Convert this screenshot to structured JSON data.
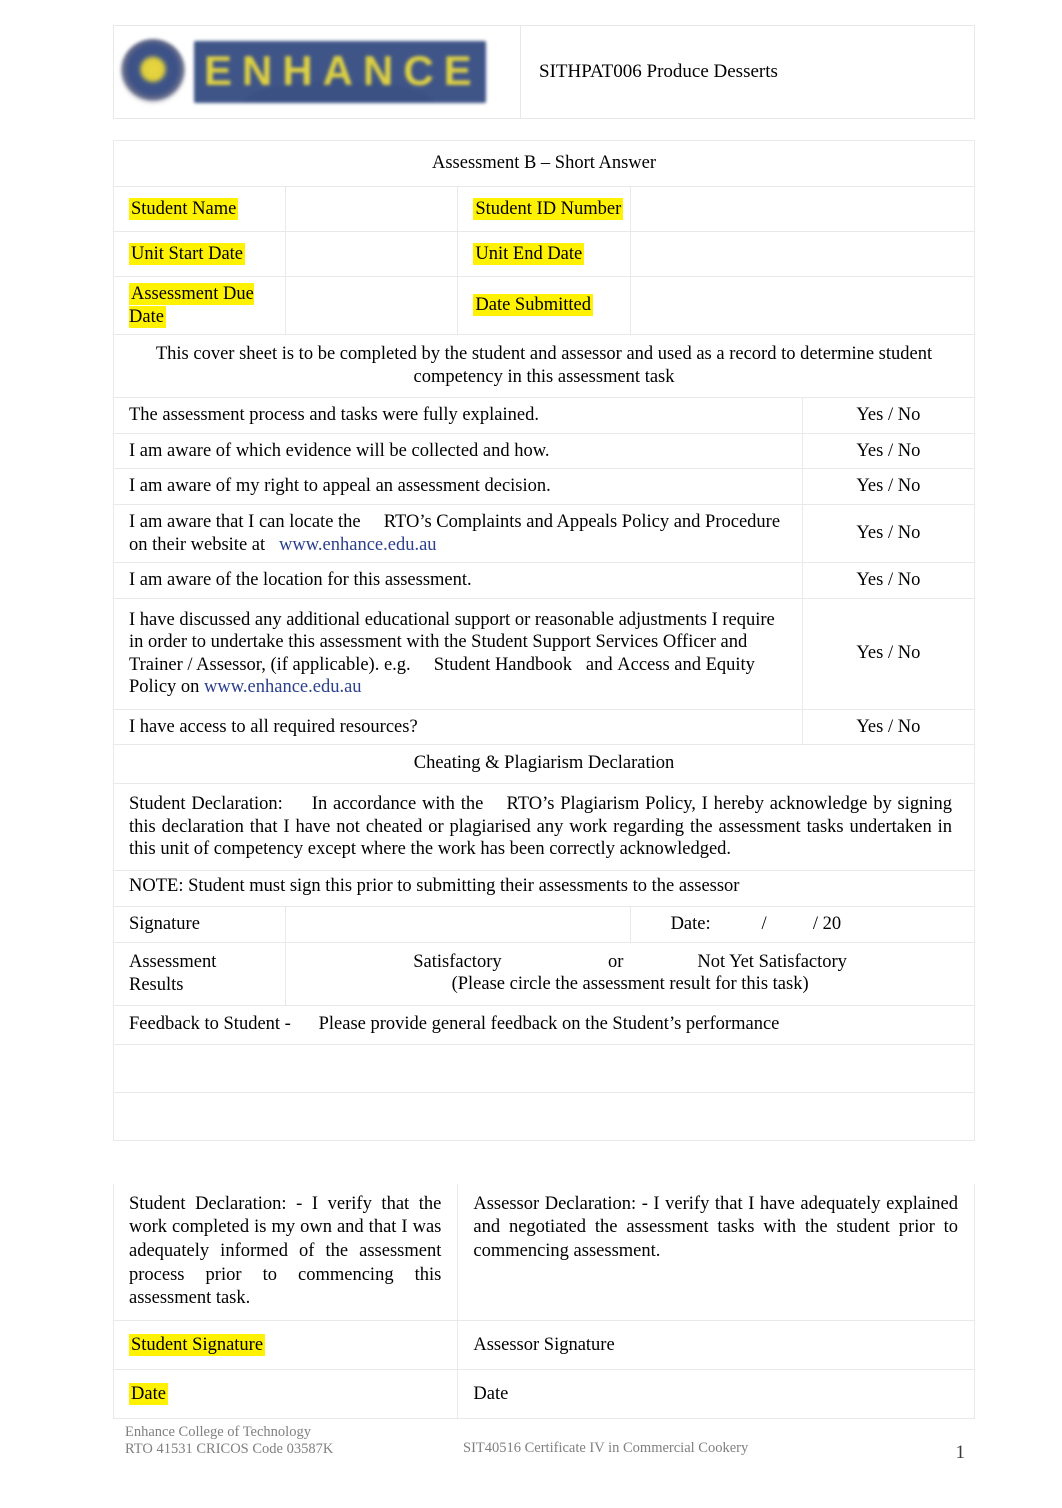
{
  "document": {
    "unit_title": "SITHPAT006 Produce Desserts",
    "assessment_title": "Assessment B – Short Answer",
    "logo_wordmark": "ENHANCE",
    "logo_colors": {
      "band": "#3f5588",
      "letters": "#ddd043",
      "emblem_center": "#e8d641"
    },
    "highlight_color": "#fff200",
    "link_color": "#2b3f8c"
  },
  "student_info": {
    "rows": [
      {
        "left_label": "Student Name",
        "left_value": "",
        "right_label": "Student ID Number",
        "right_value": ""
      },
      {
        "left_label": "Unit Start Date",
        "left_value": "",
        "right_label": "Unit End Date",
        "right_value": ""
      },
      {
        "left_label": "Assessment Due Date",
        "left_value": "",
        "right_label": "Date Submitted",
        "right_value": ""
      }
    ]
  },
  "cover_sheet_note": "This cover sheet is to be completed by the student and assessor and used as a record to determine student competency in this assessment task",
  "checklist": {
    "answer_option": "Yes / No",
    "items": [
      {
        "text": "The assessment process and tasks were fully explained."
      },
      {
        "text": "I am aware of which evidence will be collected and how."
      },
      {
        "text": "I am aware of my right to appeal an assessment decision."
      },
      {
        "text_part1": "I am aware that I can locate the ",
        "text_part2": "RTO",
        "text_part3": "’s Complaints and Appeals Policy and Procedure on their website at ",
        "link": "www.enhance.edu.au"
      },
      {
        "text": "I am aware of the location for this assessment."
      },
      {
        "text_part1": "I have discussed any additional educational support or reasonable adjustments I require in order to undertake this assessment with the Student Support Services Officer and Trainer / Assessor, (if applicable). e.g.",
        "text_part2": "Student Handbook",
        "text_part3": "and",
        "text_part4": "Access and Equity Policy",
        "text_part5": "on",
        "link": "www.enhance.edu.au"
      },
      {
        "text": "I have access to all required resources?"
      }
    ]
  },
  "plagiarism": {
    "heading": "Cheating & Plagiarism Declaration",
    "declaration_part1": "Student Declaration:",
    "declaration_part2": "In accordance with the",
    "declaration_part3": "RTO",
    "declaration_part4": "’s Plagiarism Policy, I hereby acknowledge by signing this declaration that I have not cheated or plagiarised any work regarding the assessment tasks undertaken in this unit of competency except where the work has been correctly acknowledged.",
    "note": "NOTE: Student must sign this prior to submitting their assessments to the assessor"
  },
  "signature_block": {
    "signature_label": "Signature",
    "date_label": "Date:",
    "date_pattern": "/          / 20"
  },
  "assessment_results": {
    "label_line1": "Assessment",
    "label_line2": "Results",
    "options": "Satisfactory                       or                Not Yet Satisfactory",
    "instruction": "(Please circle the assessment result for this task)"
  },
  "feedback": {
    "label": "Feedback to Student -",
    "prompt": "Please provide general feedback on the Student’s performance"
  },
  "final_declarations": {
    "student": "Student Declaration: -    I verify that the work completed is my own and that I was adequately informed of the assessment process prior to commencing this assessment task.",
    "assessor": "Assessor Declaration: -    I verify that I have adequately explained and negotiated the assessment tasks with the student prior to commencing assessment.",
    "student_signature_label": "Student Signature",
    "assessor_signature_label": "Assessor Signature",
    "student_date_label": "Date",
    "assessor_date_label": "Date"
  },
  "footer": {
    "college": "Enhance College of Technology",
    "rto": "RTO 41531 CRICOS Code 03587K",
    "qualification": "SIT40516 Certificate IV in Commercial Cookery",
    "page_number": "1"
  }
}
